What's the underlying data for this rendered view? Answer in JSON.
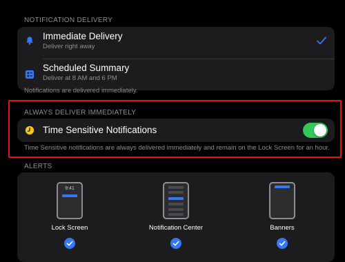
{
  "notification_delivery": {
    "header": "NOTIFICATION DELIVERY",
    "options": [
      {
        "title": "Immediate Delivery",
        "subtitle": "Deliver right away",
        "icon": "bell-icon",
        "selected": true
      },
      {
        "title": "Scheduled Summary",
        "subtitle": "Deliver at 8 AM and 6 PM",
        "icon": "summary-icon",
        "selected": false
      }
    ],
    "footer": "Notifications are delivered immediately."
  },
  "always_deliver": {
    "header": "ALWAYS DELIVER IMMEDIATELY",
    "title": "Time Sensitive Notifications",
    "icon": "clock-icon",
    "enabled": true,
    "footer": "Time Sensitive notifications are always delivered immediately and remain on the Lock Screen for an hour."
  },
  "alerts": {
    "header": "ALERTS",
    "lock_screen_time": "9:41",
    "options": [
      {
        "label": "Lock Screen",
        "checked": true
      },
      {
        "label": "Notification Center",
        "checked": true
      },
      {
        "label": "Banners",
        "checked": true
      }
    ]
  },
  "colors": {
    "accent": "#3478f6",
    "toggle_on": "#34c759",
    "highlight": "#e0141b",
    "clock_icon": "#f5c518"
  }
}
